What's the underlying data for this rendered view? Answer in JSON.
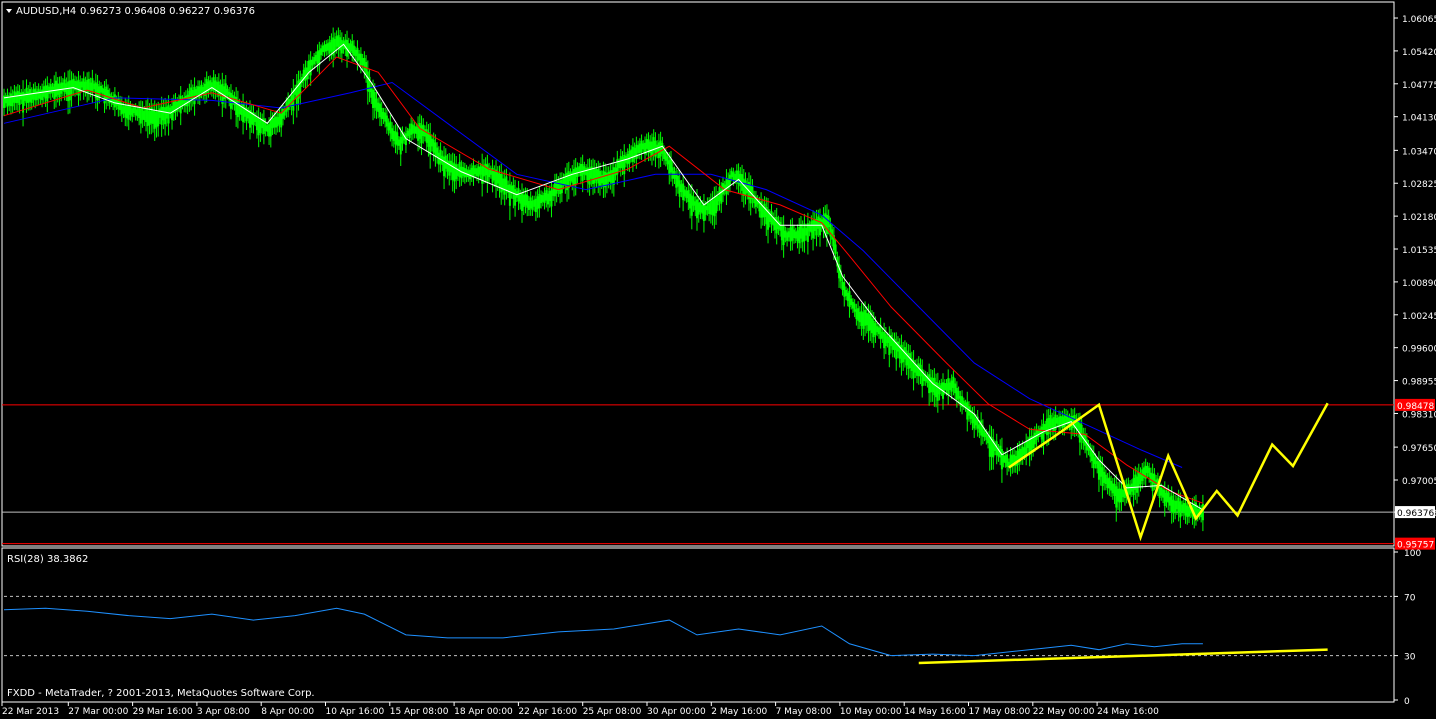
{
  "header": {
    "symbol_label": "AUDUSD,H4",
    "ohlc": "0.96273 0.96408 0.96227 0.96376"
  },
  "rsi_panel": {
    "label": "RSI(28) 38.3862"
  },
  "footer": {
    "copyright": "FXDD - MetaTrader, ? 2001-2013, MetaQuotes Software Corp."
  },
  "colors": {
    "background": "#000000",
    "frame": "#ffffff",
    "bull_candle": "#00ff00",
    "ma_fast": "#ffffff",
    "ma_mid": "#ff0000",
    "ma_slow": "#0000ff",
    "rsi_line": "#1e90ff",
    "projection": "#ffff00",
    "resistance_line": "#ff0000",
    "support_line": "#ff0000",
    "current_price_line": "#c0c0c0"
  },
  "chart_data": [
    {
      "type": "line",
      "title": "AUDUSD,H4",
      "price_axis_ticks": [
        1.06065,
        1.0542,
        1.04775,
        1.0413,
        1.0347,
        1.02825,
        1.0218,
        1.01535,
        1.0089,
        1.00245,
        0.996,
        0.98955,
        0.9831,
        0.9765,
        0.97005,
        0.96376
      ],
      "ylim": [
        0.9575,
        1.0634
      ],
      "x_tick_labels": [
        "22 Mar 2013",
        "27 Mar 00:00",
        "29 Mar 16:00",
        "3 Apr 08:00",
        "8 Apr 00:00",
        "10 Apr 16:00",
        "15 Apr 08:00",
        "18 Apr 00:00",
        "22 Apr 16:00",
        "25 Apr 08:00",
        "30 Apr 00:00",
        "2 May 16:00",
        "7 May 08:00",
        "10 May 00:00",
        "14 May 16:00",
        "17 May 08:00",
        "22 May 00:00",
        "24 May 16:00"
      ],
      "horizontal_lines": [
        {
          "value": 0.98478,
          "label": "0.98478",
          "color": "#ff0000"
        },
        {
          "value": 0.96376,
          "label": "0.96376",
          "color": "#c0c0c0"
        },
        {
          "value": 0.95757,
          "label": "0.95757",
          "color": "#ff0000"
        }
      ],
      "price_path": [
        [
          0,
          1.0445
        ],
        [
          4,
          1.0455
        ],
        [
          8,
          1.047
        ],
        [
          12,
          1.0478
        ],
        [
          14,
          1.0465
        ],
        [
          17,
          1.043
        ],
        [
          20,
          1.042
        ],
        [
          22,
          1.0415
        ],
        [
          24,
          1.0425
        ],
        [
          27,
          1.0455
        ],
        [
          30,
          1.0475
        ],
        [
          32,
          1.0465
        ],
        [
          34,
          1.043
        ],
        [
          36,
          1.041
        ],
        [
          38,
          1.039
        ],
        [
          40,
          1.041
        ],
        [
          42,
          1.046
        ],
        [
          44,
          1.051
        ],
        [
          46,
          1.0545
        ],
        [
          48,
          1.056
        ],
        [
          50,
          1.055
        ],
        [
          52,
          1.052
        ],
        [
          53,
          1.046
        ],
        [
          55,
          1.041
        ],
        [
          57,
          1.036
        ],
        [
          59,
          1.039
        ],
        [
          61,
          1.038
        ],
        [
          63,
          1.033
        ],
        [
          65,
          1.031
        ],
        [
          67,
          1.03
        ],
        [
          69,
          1.031
        ],
        [
          71,
          1.03
        ],
        [
          73,
          1.027
        ],
        [
          76,
          1.024
        ],
        [
          79,
          1.026
        ],
        [
          81,
          1.029
        ],
        [
          83,
          1.031
        ],
        [
          85,
          1.03
        ],
        [
          87,
          1.029
        ],
        [
          89,
          1.032
        ],
        [
          91,
          1.0345
        ],
        [
          93,
          1.036
        ],
        [
          95,
          1.035
        ],
        [
          97,
          1.029
        ],
        [
          99,
          1.025
        ],
        [
          101,
          1.023
        ],
        [
          103,
          1.025
        ],
        [
          105,
          1.03
        ],
        [
          107,
          1.028
        ],
        [
          109,
          1.024
        ],
        [
          111,
          1.021
        ],
        [
          113,
          1.018
        ],
        [
          115,
          1.0185
        ],
        [
          117,
          1.02
        ],
        [
          119,
          1.021
        ],
        [
          120,
          1.015
        ],
        [
          121,
          1.008
        ],
        [
          123,
          1.003
        ],
        [
          125,
          1.001
        ],
        [
          127,
          0.998
        ],
        [
          129,
          0.996
        ],
        [
          131,
          0.993
        ],
        [
          133,
          0.99
        ],
        [
          135,
          0.988
        ],
        [
          137,
          0.989
        ],
        [
          138,
          0.986
        ],
        [
          140,
          0.982
        ],
        [
          142,
          0.978
        ],
        [
          144,
          0.975
        ],
        [
          145,
          0.973
        ],
        [
          147,
          0.9755
        ],
        [
          149,
          0.979
        ],
        [
          151,
          0.981
        ],
        [
          153,
          0.982
        ],
        [
          155,
          0.981
        ],
        [
          157,
          0.975
        ],
        [
          159,
          0.97
        ],
        [
          161,
          0.967
        ],
        [
          163,
          0.969
        ],
        [
          165,
          0.972
        ],
        [
          167,
          0.968
        ],
        [
          169,
          0.965
        ],
        [
          171,
          0.964
        ],
        [
          173,
          0.9638
        ]
      ],
      "ma_fast": [
        [
          0,
          1.045
        ],
        [
          10,
          1.047
        ],
        [
          16,
          1.044
        ],
        [
          24,
          1.042
        ],
        [
          30,
          1.047
        ],
        [
          38,
          1.04
        ],
        [
          44,
          1.05
        ],
        [
          49,
          1.0555
        ],
        [
          53,
          1.048
        ],
        [
          58,
          1.037
        ],
        [
          66,
          1.0305
        ],
        [
          74,
          1.026
        ],
        [
          82,
          1.03
        ],
        [
          90,
          1.033
        ],
        [
          95,
          1.0355
        ],
        [
          101,
          1.024
        ],
        [
          106,
          1.029
        ],
        [
          112,
          1.02
        ],
        [
          118,
          1.02
        ],
        [
          121,
          1.01
        ],
        [
          126,
          1.001
        ],
        [
          134,
          0.989
        ],
        [
          140,
          0.983
        ],
        [
          144,
          0.975
        ],
        [
          150,
          0.9795
        ],
        [
          154,
          0.9815
        ],
        [
          158,
          0.974
        ],
        [
          162,
          0.9685
        ],
        [
          167,
          0.969
        ],
        [
          173,
          0.9642
        ]
      ],
      "ma_mid": [
        [
          0,
          1.0415
        ],
        [
          12,
          1.0465
        ],
        [
          20,
          1.043
        ],
        [
          30,
          1.046
        ],
        [
          40,
          1.042
        ],
        [
          48,
          1.053
        ],
        [
          54,
          1.05
        ],
        [
          60,
          1.039
        ],
        [
          70,
          1.031
        ],
        [
          80,
          1.027
        ],
        [
          90,
          1.031
        ],
        [
          96,
          1.0355
        ],
        [
          104,
          1.027
        ],
        [
          112,
          1.024
        ],
        [
          118,
          1.0205
        ],
        [
          122,
          1.014
        ],
        [
          128,
          1.004
        ],
        [
          136,
          0.993
        ],
        [
          142,
          0.985
        ],
        [
          148,
          0.98
        ],
        [
          156,
          0.979
        ],
        [
          162,
          0.973
        ],
        [
          168,
          0.968
        ],
        [
          173,
          0.9655
        ]
      ],
      "ma_slow": [
        [
          0,
          1.04
        ],
        [
          16,
          1.045
        ],
        [
          30,
          1.0445
        ],
        [
          40,
          1.043
        ],
        [
          50,
          1.046
        ],
        [
          56,
          1.048
        ],
        [
          64,
          1.04
        ],
        [
          74,
          1.03
        ],
        [
          84,
          1.027
        ],
        [
          94,
          1.03
        ],
        [
          102,
          1.03
        ],
        [
          110,
          1.027
        ],
        [
          118,
          1.022
        ],
        [
          124,
          1.015
        ],
        [
          132,
          1.004
        ],
        [
          140,
          0.993
        ],
        [
          148,
          0.986
        ],
        [
          156,
          0.981
        ],
        [
          164,
          0.976
        ],
        [
          170,
          0.9725
        ]
      ],
      "projection_path": [
        [
          145,
          0.9725
        ],
        [
          152,
          0.979
        ],
        [
          158,
          0.9848
        ],
        [
          164,
          0.9588
        ],
        [
          168,
          0.9748
        ],
        [
          172,
          0.9625
        ],
        [
          175,
          0.9679
        ],
        [
          178,
          0.9631
        ],
        [
          183,
          0.977
        ],
        [
          186,
          0.9728
        ],
        [
          191,
          0.9851
        ]
      ]
    },
    {
      "type": "line",
      "title": "RSI(28) 38.3862",
      "axis_ticks": [
        100,
        70,
        30,
        0
      ],
      "levels": [
        70,
        30
      ],
      "ylim": [
        0,
        100
      ],
      "rsi_path": [
        [
          0,
          61
        ],
        [
          6,
          62
        ],
        [
          12,
          60
        ],
        [
          18,
          57
        ],
        [
          24,
          55
        ],
        [
          30,
          58
        ],
        [
          36,
          54
        ],
        [
          42,
          57
        ],
        [
          48,
          62
        ],
        [
          52,
          58
        ],
        [
          58,
          44
        ],
        [
          64,
          42
        ],
        [
          72,
          42
        ],
        [
          80,
          46
        ],
        [
          88,
          48
        ],
        [
          96,
          54
        ],
        [
          100,
          44
        ],
        [
          106,
          48
        ],
        [
          112,
          44
        ],
        [
          118,
          50
        ],
        [
          122,
          38
        ],
        [
          128,
          30
        ],
        [
          134,
          31
        ],
        [
          140,
          30
        ],
        [
          146,
          33
        ],
        [
          150,
          35
        ],
        [
          154,
          37
        ],
        [
          158,
          34
        ],
        [
          162,
          38
        ],
        [
          166,
          36
        ],
        [
          170,
          38
        ],
        [
          173,
          38
        ]
      ],
      "trendline": [
        [
          132,
          25
        ],
        [
          191,
          34
        ]
      ]
    }
  ]
}
